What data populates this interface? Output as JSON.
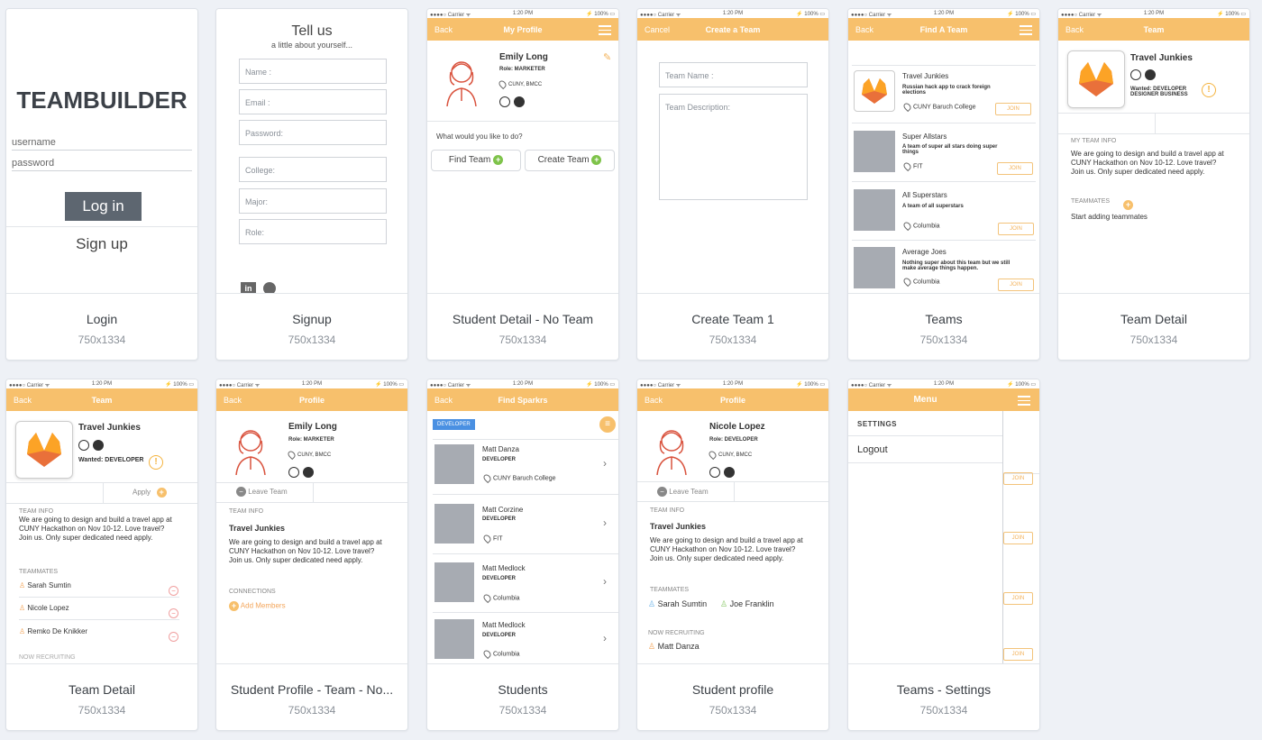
{
  "colors": {
    "accent": "#f7c06c",
    "background": "#eef1f6",
    "placeholder": "#a7abb2",
    "green": "#7ec34a"
  },
  "status": {
    "carrier": "●●●●○ Carrier ᯤ",
    "time": "1:20 PM",
    "battery": "⚡ 100% ▭"
  },
  "cards": [
    {
      "title": "Login",
      "size": "750x1334"
    },
    {
      "title": "Signup",
      "size": "750x1334"
    },
    {
      "title": "Student Detail - No Team",
      "size": "750x1334"
    },
    {
      "title": "Create Team 1",
      "size": "750x1334"
    },
    {
      "title": "Teams",
      "size": "750x1334"
    },
    {
      "title": "Team Detail",
      "size": "750x1334"
    },
    {
      "title": "Team Detail",
      "size": "750x1334"
    },
    {
      "title": "Student Profile - Team - No...",
      "size": "750x1334"
    },
    {
      "title": "Students",
      "size": "750x1334"
    },
    {
      "title": "Student profile",
      "size": "750x1334"
    },
    {
      "title": "Teams - Settings",
      "size": "750x1334"
    }
  ],
  "login": {
    "app": "TEAMBUILDER",
    "username": "username",
    "password": "password",
    "login": "Log in",
    "signup": "Sign up"
  },
  "signup": {
    "title": "Tell us",
    "subtitle": "a little about yourself...",
    "fields": [
      "Name :",
      "Email :",
      "Password:",
      "College:",
      "Major:",
      "Role:"
    ]
  },
  "myprofile": {
    "back": "Back",
    "title": "My Profile",
    "name": "Emily Long",
    "role": "Role: MARKETER",
    "school": "CUNY, BMCC",
    "prompt": "What would you like to do?",
    "find": "Find Team",
    "create": "Create Team"
  },
  "createteam": {
    "cancel": "Cancel",
    "title": "Create a Team",
    "name_ph": "Team Name :",
    "desc_ph": "Team Description:"
  },
  "findteam": {
    "back": "Back",
    "title": "Find A Team",
    "join": "JOIN",
    "teams": [
      {
        "name": "Travel Junkies",
        "desc": "Russian hack app to crack foreign elections",
        "loc": "CUNY Baruch College"
      },
      {
        "name": "Super Allstars",
        "desc": "A team of super all stars doing super things",
        "loc": "FIT"
      },
      {
        "name": "All Superstars",
        "desc": "A team of all superstars",
        "loc": "Columbia"
      },
      {
        "name": "Average Joes",
        "desc": "Nothing super about this team but we still make average things happen.",
        "loc": "Columbia"
      }
    ]
  },
  "teamdetail": {
    "back": "Back",
    "title": "Team",
    "name": "Travel Junkies",
    "wanted": "Wanted: DEVELOPER DESIGNER BUSINESS",
    "info_label": "MY TEAM INFO",
    "info": "We are going to design and build a travel app at CUNY Hackathon on Nov 10-12. Love travel? Join us. Only super dedicated need apply.",
    "mates_label": "TEAMMATES",
    "start": "Start adding teammates"
  },
  "teamdetail2": {
    "back": "Back",
    "title": "Team",
    "name": "Travel Junkies",
    "wanted": "Wanted: DEVELOPER",
    "apply": "Apply",
    "info_label": "TEAM INFO",
    "info": "We are going to design and build a travel app at CUNY Hackathon on Nov 10-12. Love travel? Join us. Only super dedicated need apply.",
    "mates_label": "TEAMMATES",
    "mates": [
      "Sarah Sumtin",
      "Nicole Lopez",
      "Remko De Knikker"
    ],
    "recruit": "NOW RECRUITING"
  },
  "profile2": {
    "back": "Back",
    "title": "Profile",
    "name": "Emily Long",
    "role": "Role: MARKETER",
    "school": "CUNY, BMCC",
    "leave": "Leave Team",
    "info_label": "TEAM INFO",
    "team": "Travel Junkies",
    "info": "We are going to design and build a travel app at CUNY Hackathon on Nov 10-12. Love travel? Join us. Only super dedicated need apply.",
    "conn": "CONNECTIONS",
    "add": "Add Members"
  },
  "students": {
    "back": "Back",
    "title": "Find Sparkrs",
    "filter": "DEVELOPER",
    "list": [
      {
        "name": "Matt Danza",
        "role": "DEVELOPER",
        "loc": "CUNY Baruch College"
      },
      {
        "name": "Matt Corzine",
        "role": "DEVELOPER",
        "loc": "FIT"
      },
      {
        "name": "Matt Medlock",
        "role": "DEVELOPER",
        "loc": "Columbia"
      },
      {
        "name": "Matt Medlock",
        "role": "DEVELOPER",
        "loc": "Columbia"
      }
    ]
  },
  "profile3": {
    "back": "Back",
    "title": "Profile",
    "name": "Nicole Lopez",
    "role": "Role: DEVELOPER",
    "school": "CUNY, BMCC",
    "leave": "Leave Team",
    "info_label": "TEAM INFO",
    "team": "Travel Junkies",
    "info": "We are going to design and build a travel app at CUNY Hackathon on Nov 10-12. Love travel? Join us. Only super dedicated need apply.",
    "mates_label": "TEAMMATES",
    "mate1": "Sarah Sumtin",
    "mate2": "Joe Franklin",
    "recruit": "NOW RECRUITING",
    "recruit_name": "Matt Danza"
  },
  "settings": {
    "title": "Menu",
    "section": "SETTINGS",
    "logout": "Logout",
    "join": "JOIN"
  }
}
